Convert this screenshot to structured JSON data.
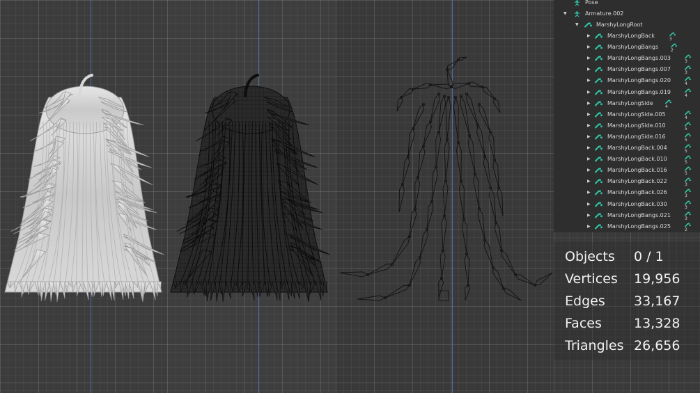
{
  "outliner": {
    "pose_label": "Pose",
    "armature_label": "Armature.002",
    "root_label": "MarshyLongRoot",
    "bones": [
      {
        "name": "MarshyLongBack",
        "count": "3"
      },
      {
        "name": "MarshyLongBangs",
        "count": "2"
      },
      {
        "name": "MarshyLongBangs.003",
        "count": "3"
      },
      {
        "name": "MarshyLongBangs.007",
        "count": "3"
      },
      {
        "name": "MarshyLongBangs.020",
        "count": "4"
      },
      {
        "name": "MarshyLongBangs.019",
        "count": "4"
      },
      {
        "name": "MarshyLongSide",
        "count": "4"
      },
      {
        "name": "MarshyLongSide.005",
        "count": "4"
      },
      {
        "name": "MarshyLongSide.010",
        "count": "5"
      },
      {
        "name": "MarshyLongSide.016",
        "count": "5"
      },
      {
        "name": "MarshyLongBack.004",
        "count": "5"
      },
      {
        "name": "MarshyLongBack.010",
        "count": "5"
      },
      {
        "name": "MarshyLongBack.016",
        "count": "5"
      },
      {
        "name": "MarshyLongBack.022",
        "count": "3"
      },
      {
        "name": "MarshyLongBack.026",
        "count": "3"
      },
      {
        "name": "MarshyLongBack.030",
        "count": "3"
      },
      {
        "name": "MarshyLongBangs.021",
        "count": "3"
      },
      {
        "name": "MarshyLongBangs.025",
        "count": "2"
      }
    ],
    "bone_icon_color": "#2fc8a8"
  },
  "stats": {
    "objects_label": "Objects",
    "objects_value": "0 / 1",
    "vertices_label": "Vertices",
    "vertices_value": "19,956",
    "edges_label": "Edges",
    "edges_value": "33,167",
    "faces_label": "Faces",
    "faces_value": "13,328",
    "triangles_label": "Triangles",
    "triangles_value": "26,656"
  },
  "viewports": [
    {
      "name": "solid-hair-view",
      "shading": "solid"
    },
    {
      "name": "wireframe-hair-view",
      "shading": "wireframe"
    },
    {
      "name": "armature-view",
      "shading": "bones"
    }
  ]
}
